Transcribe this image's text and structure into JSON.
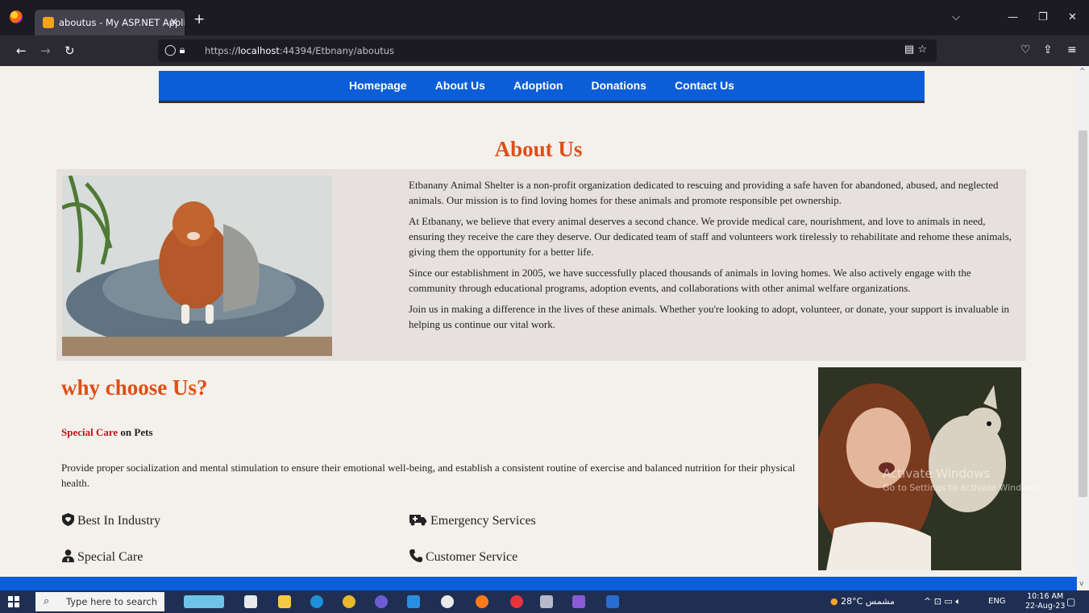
{
  "browser": {
    "tab_title": "aboutus - My ASP.NET Applica",
    "tab_close": "×",
    "new_tab": "+",
    "url_host_prefix": "https://",
    "url_host": "localhost",
    "url_path": ":44394/Etbnany/aboutus"
  },
  "site_nav": {
    "items": [
      "Homepage",
      "About Us",
      "Adoption",
      "Donations",
      "Contact Us"
    ]
  },
  "about": {
    "title": "About Us",
    "paragraphs": [
      "Etbanany Animal Shelter is a non-profit organization dedicated to rescuing and providing a safe haven for abandoned, abused, and neglected animals. Our mission is to find loving homes for these animals and promote responsible pet ownership.",
      "At Etbanany, we believe that every animal deserves a second chance. We provide medical care, nourishment, and love to animals in need, ensuring they receive the care they deserve. Our dedicated team of staff and volunteers work tirelessly to rehabilitate and rehome these animals, giving them the opportunity for a better life.",
      "Since our establishment in 2005, we have successfully placed thousands of animals in loving homes. We also actively engage with the community through educational programs, adoption events, and collaborations with other animal welfare organizations.",
      "Join us in making a difference in the lives of these animals. Whether you're looking to adopt, volunteer, or donate, your support is invaluable in helping us continue our vital work."
    ]
  },
  "why": {
    "title": "why choose Us?",
    "special_red": "Special Care",
    "special_rest": " on Pets",
    "description": "Provide proper socialization and mental stimulation to ensure their emotional well-being, and establish a consistent routine of exercise and balanced nutrition for their physical health.",
    "features": {
      "best": "Best In Industry",
      "emergency": "Emergency Services",
      "special": "Special Care",
      "customer": "Customer Service"
    }
  },
  "watermark": {
    "line1": "Activate Windows",
    "line2": "Go to Settings to activate Windows."
  },
  "taskbar": {
    "search_placeholder": "Type here to search",
    "weather": "28°C  مشمس",
    "lang": "ENG",
    "time": "10:16 AM",
    "date": "22-Aug-23"
  },
  "colors": {
    "accent_orange": "#e04e14",
    "nav_blue": "#0b5ed7",
    "special_red": "#c0141a"
  }
}
